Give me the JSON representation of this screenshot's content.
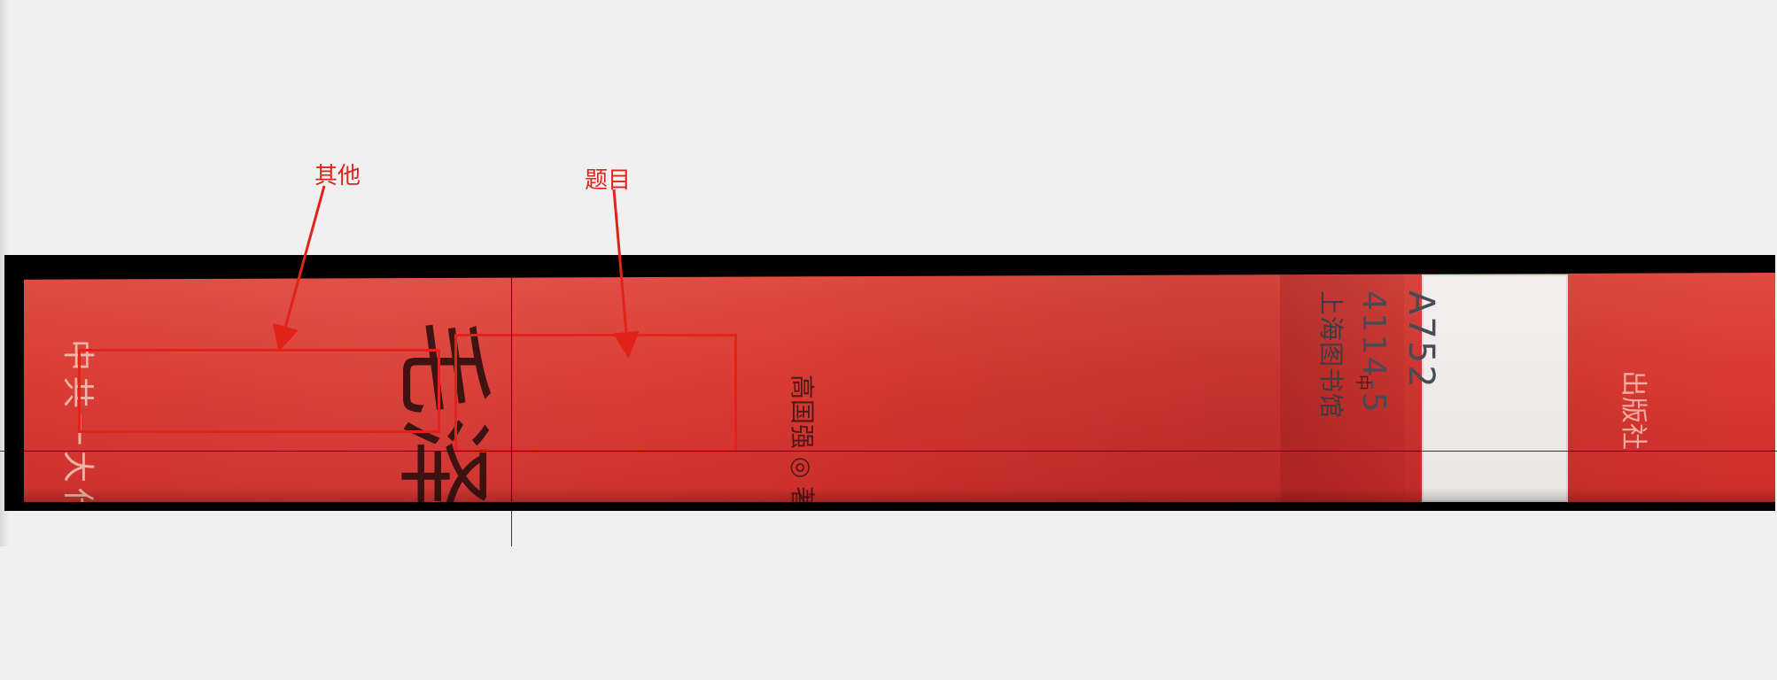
{
  "annotations": {
    "other_label": "其他",
    "title_label": "题目"
  },
  "book_spine": {
    "series": "中共一大代表丛书",
    "title": "毛泽东",
    "author_line": "高国强 ◎ 著",
    "center_mark": "中",
    "call_number": {
      "line1": "A752",
      "line2": "4114-5",
      "line3": "上海图书馆"
    },
    "publisher": "出版社"
  },
  "colors": {
    "annotation_red": "#e2231a",
    "spine_red": "#d93a33",
    "background": "#f0f0f0"
  }
}
